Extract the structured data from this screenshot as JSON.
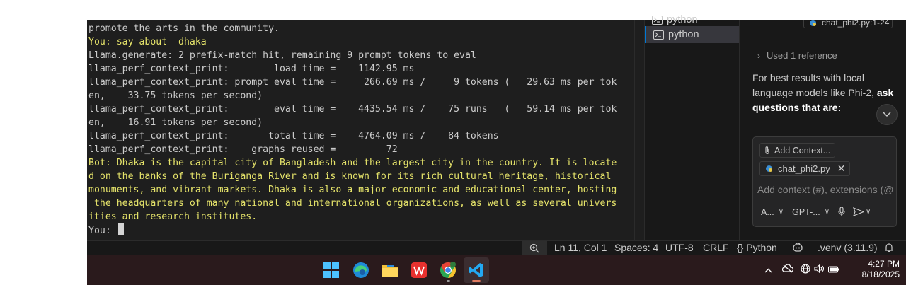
{
  "terminal": {
    "lines": [
      "promote the arts in the community.",
      "You: say about  dhaka",
      "Llama.generate: 2 prefix-match hit, remaining 9 prompt tokens to eval",
      "llama_perf_context_print:        load time =    1142.95 ms",
      "llama_perf_context_print: prompt eval time =     266.69 ms /     9 tokens (   29.63 ms per tok",
      "en,    33.75 tokens per second)",
      "llama_perf_context_print:        eval time =    4435.54 ms /    75 runs   (   59.14 ms per tok",
      "en,    16.91 tokens per second)",
      "llama_perf_context_print:       total time =    4764.09 ms /    84 tokens",
      "llama_perf_context_print:    graphs reused =         72",
      "Bot: Dhaka is the capital city of Bangladesh and the largest city in the country. It is locate",
      "d on the banks of the Buriganga River and is known for its rich cultural heritage, historical",
      "monuments, and vibrant markets. Dhaka is also a major economic and educational center, hosting",
      " the headquarters of many national and international organizations, as well as several univers",
      "ities and research institutes."
    ],
    "prompt": "You: "
  },
  "terminal_tabs": {
    "items": [
      {
        "label": "python"
      },
      {
        "label": "python"
      }
    ]
  },
  "chat": {
    "top_file_chip": "chat_phi2.py:1-24",
    "reference": "Used 1 reference",
    "reply_text": "For best results with local language models like Phi-2, ",
    "reply_bold": "ask questions that are:",
    "add_context_label": "Add Context...",
    "file_chip": "chat_phi2.py",
    "input_placeholder": "Add context (#), extensions (@",
    "mode_label": "A...",
    "model_label": "GPT-..."
  },
  "status_bar": {
    "position": "Ln 11, Col 1",
    "spaces": "Spaces: 4",
    "encoding": "UTF-8",
    "eol": "CRLF",
    "language": "Python",
    "interpreter": ".venv (3.11.9)"
  },
  "taskbar": {
    "time": "4:27 PM",
    "date": "8/18/2025"
  }
}
